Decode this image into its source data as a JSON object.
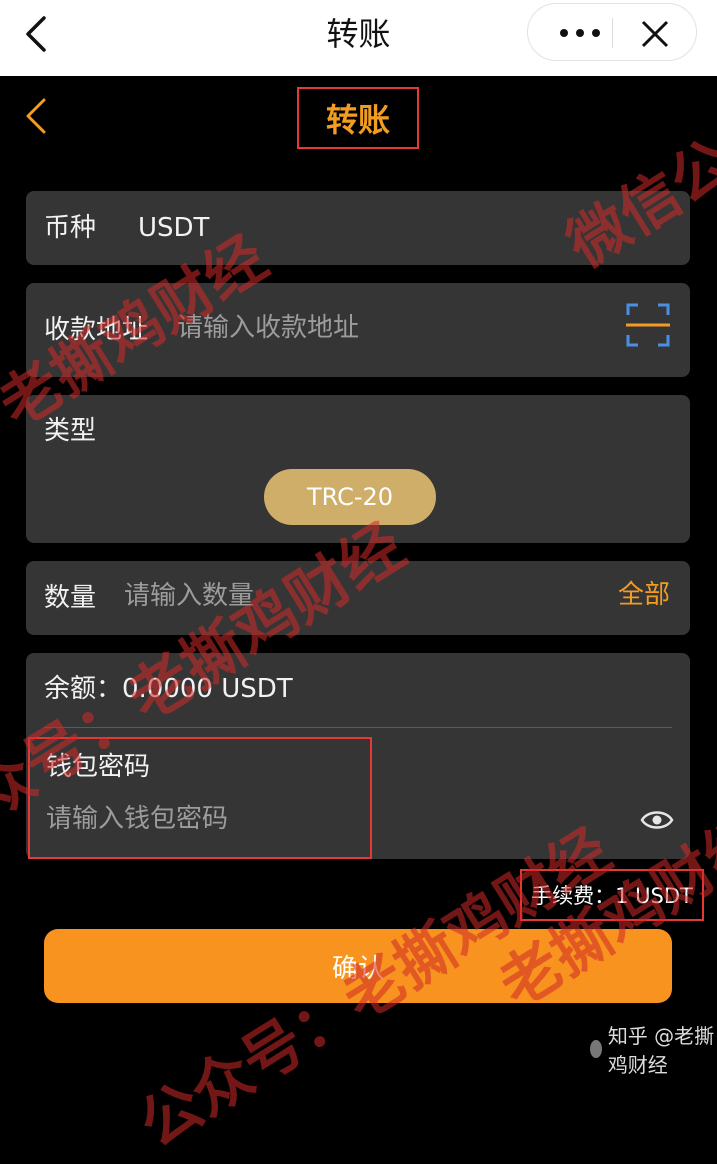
{
  "wechat_bar": {
    "title": "转账"
  },
  "header": {
    "title": "转账"
  },
  "currency": {
    "label": "币种",
    "value": "USDT"
  },
  "address": {
    "label": "收款地址",
    "placeholder": "请输入收款地址"
  },
  "type": {
    "label": "类型",
    "selected": "TRC-20"
  },
  "amount": {
    "label": "数量",
    "placeholder": "请输入数量",
    "all_label": "全部"
  },
  "balance": {
    "text": "余额：0.0000 USDT"
  },
  "password": {
    "label": "钱包密码",
    "placeholder": "请输入钱包密码"
  },
  "fee": {
    "text": "手续费：1 USDT"
  },
  "confirm": {
    "label": "确认"
  },
  "watermark": {
    "text1": "微信公",
    "text2": "老撕鸡财经",
    "text3": "众号：老撕鸡财经",
    "text4": "老撕鸡财经",
    "text5": "公众号：老撕鸡财经",
    "footer": "知乎 @老撕鸡财经"
  },
  "colors": {
    "accent": "#f39c22",
    "button": "#f7931e",
    "card": "#353535",
    "pill": "#cfae6a",
    "highlight_border": "#e53935"
  }
}
